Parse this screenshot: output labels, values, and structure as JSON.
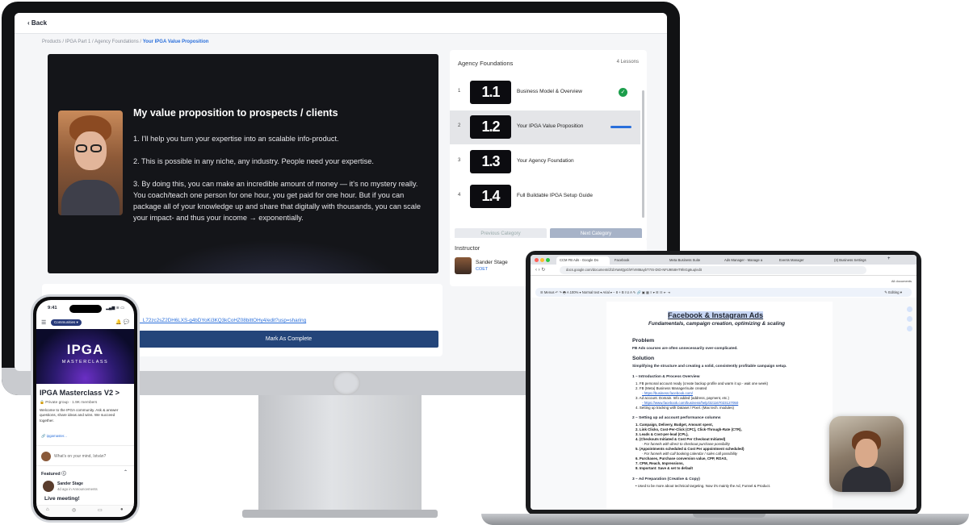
{
  "monitor": {
    "back_label": "Back",
    "breadcrumb": {
      "path": "Products / IPGA Part 1 / Agency Foundations /",
      "current": "Your IPGA Value Proposition"
    },
    "video": {
      "title": "My value proposition to prospects / clients",
      "p1": "1. I'll help you turn your expertise into an scalable info-product.",
      "p2": "2. This is possible in any niche, any industry. People need your expertise.",
      "p3": "3. By doing this, you can make an incredible amount of money — it's no mystery really. You coach/teach one person for one hour, you get paid for one hour. But if you can package all of your knowledge up and share that digitally with thousands, you can scale your impact- and thus your income → exponentially."
    },
    "lessons_panel": {
      "title": "Agency Foundations",
      "count": "4 Lessons",
      "items": [
        {
          "num": "1",
          "badge": "1.1",
          "label": "Business Model & Overview"
        },
        {
          "num": "2",
          "badge": "1.2",
          "label": "Your IPGA Value Proposition"
        },
        {
          "num": "3",
          "badge": "1.3",
          "label": "Your Agency Foundation"
        },
        {
          "num": "4",
          "badge": "1.4",
          "label": "Full Buildable IPGA Setup Guide"
        }
      ],
      "prev_label": "Previous Category",
      "next_label": "Next Category"
    },
    "instructor": {
      "heading": "Instructor",
      "name": "Sander Stage",
      "role": "COET"
    },
    "doc_link": "l_L72zc2sZ2DH6LXS-g4bDYoKi3KQ3kCoHZ08bittOHy4/edit?usp=sharing",
    "mark_complete_label": "Mark As Complete"
  },
  "phone": {
    "time": "9:41",
    "status": "▂▄▆ ≋ ▭",
    "community_pill": "Communities ▾",
    "hero_title": "IPGA",
    "hero_subtitle": "MASTERCLASS",
    "group_title": "IPGA Masterclass V2 >",
    "group_meta": "🔒 Private group · 1.9K members",
    "description": "Welcome to the IPGA community. Ask & answer questions, share ideas and wins. We succeed together.",
    "chip": "🔗 ipgamaster...",
    "mind_placeholder": "What's on your mind, István?",
    "featured_label": "Featured ⓘ",
    "post_author": "Sander Stage",
    "post_meta": "4d ago in Announcements",
    "post_title": "Live meeting!"
  },
  "laptop": {
    "tabs": [
      "CCM FB Ads - Google Do",
      "Facebook",
      "Meta Business Suite",
      "Ads Manager - Manage a",
      "Events Manager",
      "(3) Business Settings"
    ],
    "url": "docs.google.com/document/d/1bYaMQpGhFiVMt6aybT7rS-DtO-NFU9I58HT9hIGg6uq/edit",
    "all_documents": "All documents",
    "toolbar": "☰ Menus   ↶ ↷ 🖶 A   100% ▾   Normal text ▾   Arial ▾   − 8 +   B I U A ✎   🔗 ▣ ▦   ≡ ▾   ☰ ☷ ⇤ ⇥",
    "editing": "✎ Editing ▾",
    "doc": {
      "title": "Facebook & Instagram Ads",
      "subtitle": "Fundamentals, campaign creation, optimizing & scaling",
      "problem_h": "Problem",
      "problem_b": "FB Ads courses are often unnecessarily over-complicated.",
      "solution_h": "Solution",
      "solution_b": "Simplifying the structure and creating a solid, consistently profitable campaign setup.",
      "sec1": "1 – Introduction & Process Overview",
      "s1": [
        "1.   FB personal account ready (create backup profile and warm it up - wait one week)",
        "2.   FB (Meta) Business Manager/suite created",
        "- https://business.facebook.com/",
        "3.   Ad account. Domain. Info added (address, payment, etc.)",
        "- https://www.facebook.com/business/help/321167023127050",
        "4.   Setting up tracking with Dataset / Pixel. (Max tech. modules)"
      ],
      "sec2": "2 – Setting up ad account performance columns",
      "s2": [
        "1.   Campaign, Delivery, Budget, Amount spent,",
        "2.   Link Clicks, Cost-Per-Click (CPC), Click-Through-Rate (CTR),",
        "3.   Leads & Cost-per-lead (CPL),",
        "4.   (Checkouts Initiated & Cost Per Checkout Initiated)",
        "- For funnels with direct to checkout purchase possibility",
        "5.   (Appointments scheduled & Cost Per appointment scheduled)",
        "- For funnels with call booking calendar / sales call possibility",
        "6.   Purchases, Purchase conversion value, CPP, ROAS,",
        "7.   CPM, Reach, Impressions,",
        "8.   Important: Save & set to default"
      ],
      "sec3": "3 – Ad Preparation (Creative & Copy)",
      "s3": "•   Used to be more about technical targeting. Now it's mainly the Ad, Funnel & Product."
    }
  }
}
